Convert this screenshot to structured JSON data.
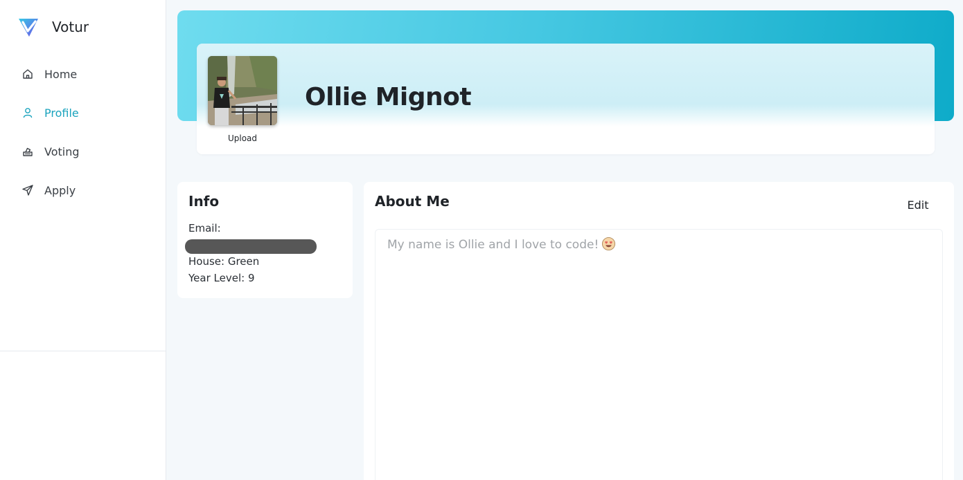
{
  "brand": {
    "name": "Votur"
  },
  "nav": {
    "items": [
      {
        "label": "Home",
        "icon": "home-icon"
      },
      {
        "label": "Profile",
        "icon": "user-icon",
        "active": true
      },
      {
        "label": "Voting",
        "icon": "ballot-box-icon"
      },
      {
        "label": "Apply",
        "icon": "send-icon"
      }
    ]
  },
  "profile": {
    "name": "Ollie Mignot",
    "upload_label": "Upload"
  },
  "info": {
    "title": "Info",
    "email_label": "Email:",
    "house": "House: Green",
    "year_level": "Year Level: 9"
  },
  "about": {
    "title": "About Me",
    "edit_label": "Edit",
    "text": "My name is Ollie and I love to code!"
  },
  "colors": {
    "accent": "#1aa3bd",
    "hero_start": "#6fdcef",
    "hero_end": "#0eabc9",
    "redaction": "#575757"
  }
}
